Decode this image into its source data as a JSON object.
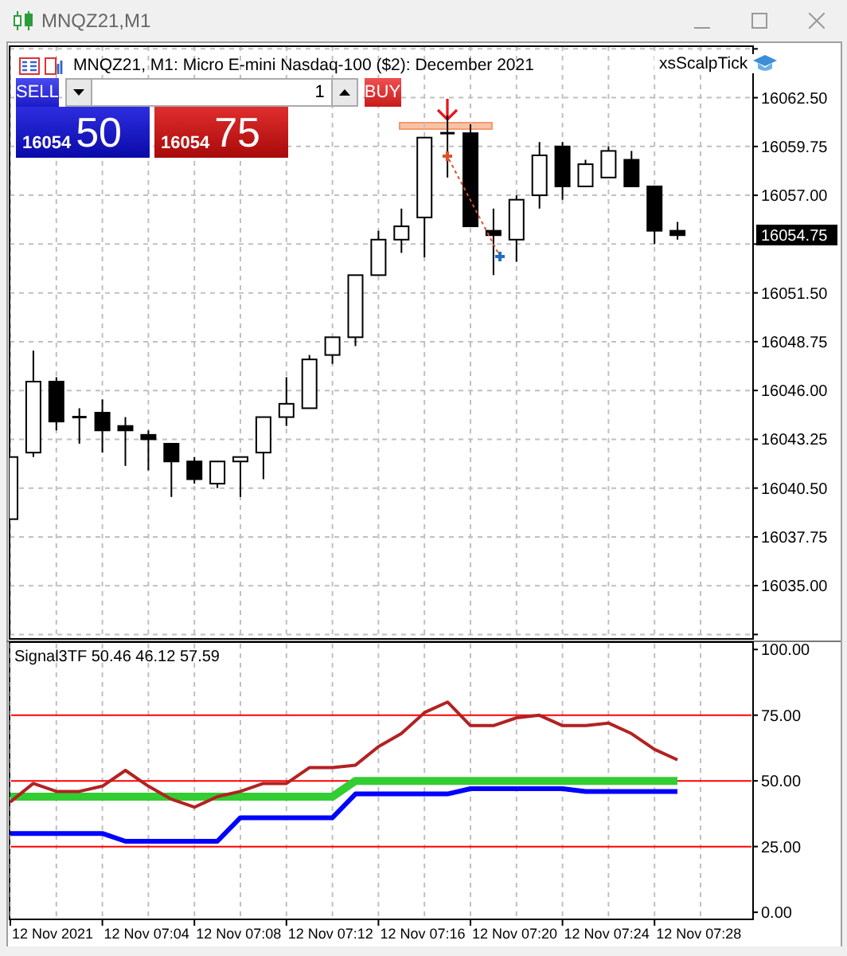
{
  "window": {
    "title": "MNQZ21,M1"
  },
  "chart": {
    "header": "MNQZ21, M1: Micro E-mini Nasdaq-100 ($2): December 2021",
    "expert": "xsScalpTick",
    "trade_panel": {
      "sell_label": "SELL",
      "buy_label": "BUY",
      "volume": "1",
      "sell_price_head": "16054",
      "sell_price_tail": "50",
      "buy_price_head": "16054",
      "buy_price_tail": "75"
    },
    "current_price": "16054.75",
    "chart_data": {
      "type": "candlestick",
      "grid": true,
      "ylim": [
        16032.0,
        16065.4
      ],
      "yticks": [
        {
          "value": 16062.5,
          "label": "16062.50"
        },
        {
          "value": 16059.75,
          "label": "16059.75"
        },
        {
          "value": 16057,
          "label": "16057.00"
        },
        {
          "value": 16051.5,
          "label": "16051.50"
        },
        {
          "value": 16048.75,
          "label": "16048.75"
        },
        {
          "value": 16046,
          "label": "16046.00"
        },
        {
          "value": 16043.25,
          "label": "16043.25"
        },
        {
          "value": 16040.5,
          "label": "16040.50"
        },
        {
          "value": 16037.75,
          "label": "16037.75"
        },
        {
          "value": 16035,
          "label": "16035.00"
        }
      ],
      "ohlc": [
        [
          16038.75,
          16042.25,
          16038.75,
          16042.25
        ],
        [
          16042.5,
          16048.25,
          16042.25,
          16046.5
        ],
        [
          16046.5,
          16046.75,
          16043.75,
          16044.25
        ],
        [
          16044.5,
          16045,
          16043,
          16044.5
        ],
        [
          16044.75,
          16045.5,
          16042.5,
          16043.75
        ],
        [
          16044,
          16044.5,
          16041.75,
          16043.75
        ],
        [
          16043.5,
          16043.75,
          16041.5,
          16043.25
        ],
        [
          16043,
          16043,
          16040,
          16042
        ],
        [
          16042,
          16042.25,
          16040.75,
          16041
        ],
        [
          16040.75,
          16042,
          16040.5,
          16042
        ],
        [
          16042,
          16042.25,
          16040,
          16042.25
        ],
        [
          16042.5,
          16044.5,
          16041,
          16044.5
        ],
        [
          16044.5,
          16046.75,
          16044,
          16045.25
        ],
        [
          16045,
          16048,
          16045,
          16047.75
        ],
        [
          16048,
          16049,
          16047.5,
          16049
        ],
        [
          16049,
          16052.5,
          16048.5,
          16052.5
        ],
        [
          16052.5,
          16055,
          16052.5,
          16054.5
        ],
        [
          16054.5,
          16056.25,
          16053.75,
          16055.25
        ],
        [
          16055.75,
          16060.25,
          16053.5,
          16060.25
        ],
        [
          16060.5,
          16061.5,
          16058,
          16060.5
        ],
        [
          16060.5,
          16061,
          16055.25,
          16055.25
        ],
        [
          16055,
          16056.25,
          16052.5,
          16054.75
        ],
        [
          16054.5,
          16057,
          16053.25,
          16056.75
        ],
        [
          16057,
          16060,
          16056.25,
          16059.25
        ],
        [
          16059.75,
          16060,
          16056.75,
          16057.5
        ],
        [
          16057.5,
          16059,
          16057.5,
          16058.75
        ],
        [
          16058,
          16059.75,
          16058,
          16059.5
        ],
        [
          16059,
          16059.5,
          16057.5,
          16057.5
        ],
        [
          16057.5,
          16057.5,
          16054.25,
          16055
        ],
        [
          16055,
          16055.5,
          16054.5,
          16054.75
        ]
      ]
    }
  },
  "indicator": {
    "time_labels": [
      "12 Nov 2021",
      "12 Nov 07:04",
      "12 Nov 07:08",
      "12 Nov 07:12",
      "12 Nov 07:16",
      "12 Nov 07:20",
      "12 Nov 07:24",
      "12 Nov 07:28"
    ],
    "chart_data": {
      "type": "line",
      "title": "Signal3TF 50.46 46.12 57.59",
      "grid": true,
      "ylim": [
        -2.7,
        102.8
      ],
      "yticks": [
        {
          "value": 100,
          "label": "100.00"
        },
        {
          "value": 75,
          "label": "75.00"
        },
        {
          "value": 50,
          "label": "50.00"
        },
        {
          "value": 25,
          "label": "25.00"
        },
        {
          "value": 0,
          "label": "0.00"
        }
      ],
      "ref_lines": [
        {
          "axis": "y",
          "value": 75,
          "color": "#ff0000"
        },
        {
          "axis": "y",
          "value": 50,
          "color": "#ff0000"
        },
        {
          "axis": "y",
          "value": 25,
          "color": "#ff0000"
        }
      ],
      "series": [
        {
          "color": "#32cd32",
          "values": [
            44,
            44,
            44,
            44,
            44,
            44,
            44,
            44,
            44,
            44,
            44,
            44,
            44,
            44,
            44,
            50,
            50,
            50,
            50,
            50,
            50,
            50,
            50,
            50,
            50,
            50,
            50,
            50,
            50,
            50
          ]
        },
        {
          "color": "#0000ff",
          "values": [
            30,
            30,
            30,
            30,
            30,
            27,
            27,
            27,
            27,
            27,
            36,
            36,
            36,
            36,
            36,
            45,
            45,
            45,
            45,
            45,
            47,
            47,
            47,
            47,
            47,
            46,
            46,
            46,
            46,
            46
          ]
        },
        {
          "color": "#b22222",
          "values": [
            42,
            49,
            46,
            46,
            48,
            54,
            48,
            43,
            40,
            44,
            46,
            49,
            49,
            55,
            55,
            56,
            63,
            68,
            76,
            80,
            71,
            71,
            74,
            75,
            71,
            71,
            72,
            68,
            62,
            58
          ]
        }
      ]
    }
  }
}
